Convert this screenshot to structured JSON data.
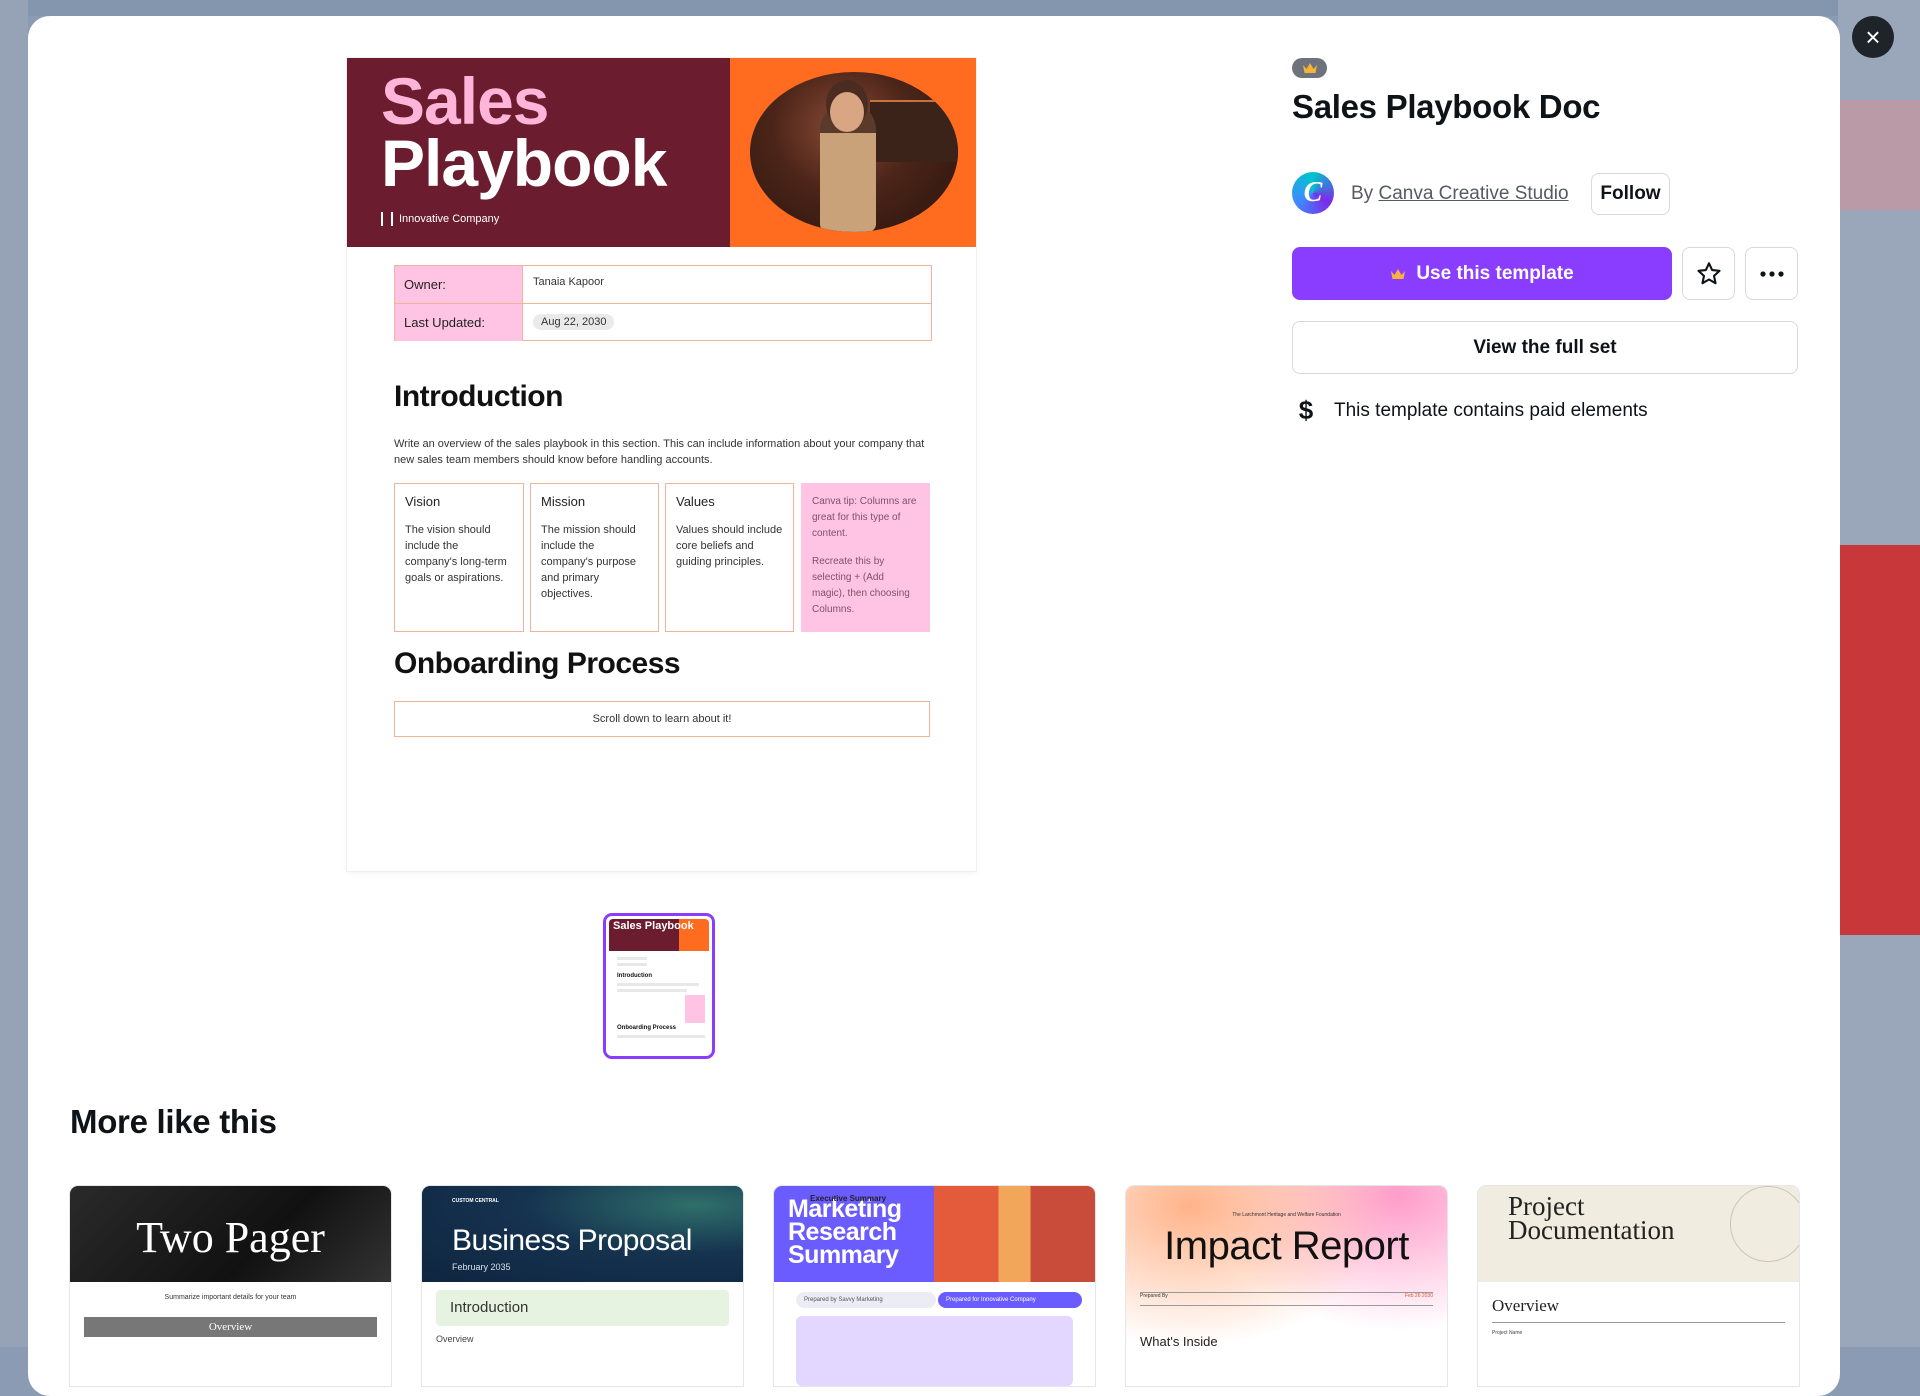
{
  "dialog": {
    "close_label": "×"
  },
  "preview": {
    "title_line1": "Sales",
    "title_line2": "Playbook",
    "company": "Innovative Company",
    "owner_label": "Owner:",
    "owner_value": "Tanaia Kapoor",
    "updated_label": "Last Updated:",
    "updated_value": "Aug 22, 2030",
    "intro_heading": "Introduction",
    "intro_text": "Write an overview of the sales playbook in this section. This can include information about your company that new sales team members should know before handling accounts.",
    "columns": [
      {
        "title": "Vision",
        "text": "The vision should include the company's long-term goals or aspirations."
      },
      {
        "title": "Mission",
        "text": "The mission should include the company's purpose and primary objectives."
      },
      {
        "title": "Values",
        "text": "Values should include core beliefs and guiding principles."
      }
    ],
    "tip_text1": "Canva tip: Columns are great for this type of content.",
    "tip_text2": "Recreate this by selecting + (Add magic), then choosing Columns.",
    "onboarding_heading": "Onboarding Process",
    "scroll_text": "Scroll down to learn about it!"
  },
  "thumbnail": {
    "title": "Sales Playbook",
    "intro": "Introduction",
    "onboarding": "Onboarding Process"
  },
  "template": {
    "title": "Sales Playbook Doc",
    "by_prefix": "By",
    "author": "Canva Creative Studio",
    "avatar_letter": "C",
    "follow_label": "Follow",
    "use_label": "Use this template",
    "view_full_set_label": "View the full set",
    "paid_symbol": "$",
    "paid_note": "This template contains paid elements"
  },
  "more_like_this": {
    "heading": "More like this",
    "cards": [
      {
        "title": "Two Pager",
        "subtitle": "Summarize important details for your team",
        "section": "Overview"
      },
      {
        "brand": "CUSTOM CENTRAL",
        "title": "Business Proposal",
        "date": "February 2035",
        "section": "Introduction",
        "sub": "Overview"
      },
      {
        "title": "Marketing Research Summary",
        "prepared_by": "Prepared by Savvy Marketing",
        "prepared_for": "Prepared for Innovative Company",
        "section": "Executive Summary"
      },
      {
        "org": "The Larchmont Heritage and Welfare Foundation",
        "title": "Impact Report",
        "prepared": "Prepared By",
        "date": "Feb 26 2030",
        "section": "What's Inside"
      },
      {
        "title": "Project Documentation",
        "section": "Overview",
        "sub": "Project Name"
      }
    ]
  },
  "colors": {
    "accent": "#8b3dff",
    "maroon": "#6b1d2f",
    "orange": "#ff6b1f",
    "pink": "#ffc4e4"
  }
}
